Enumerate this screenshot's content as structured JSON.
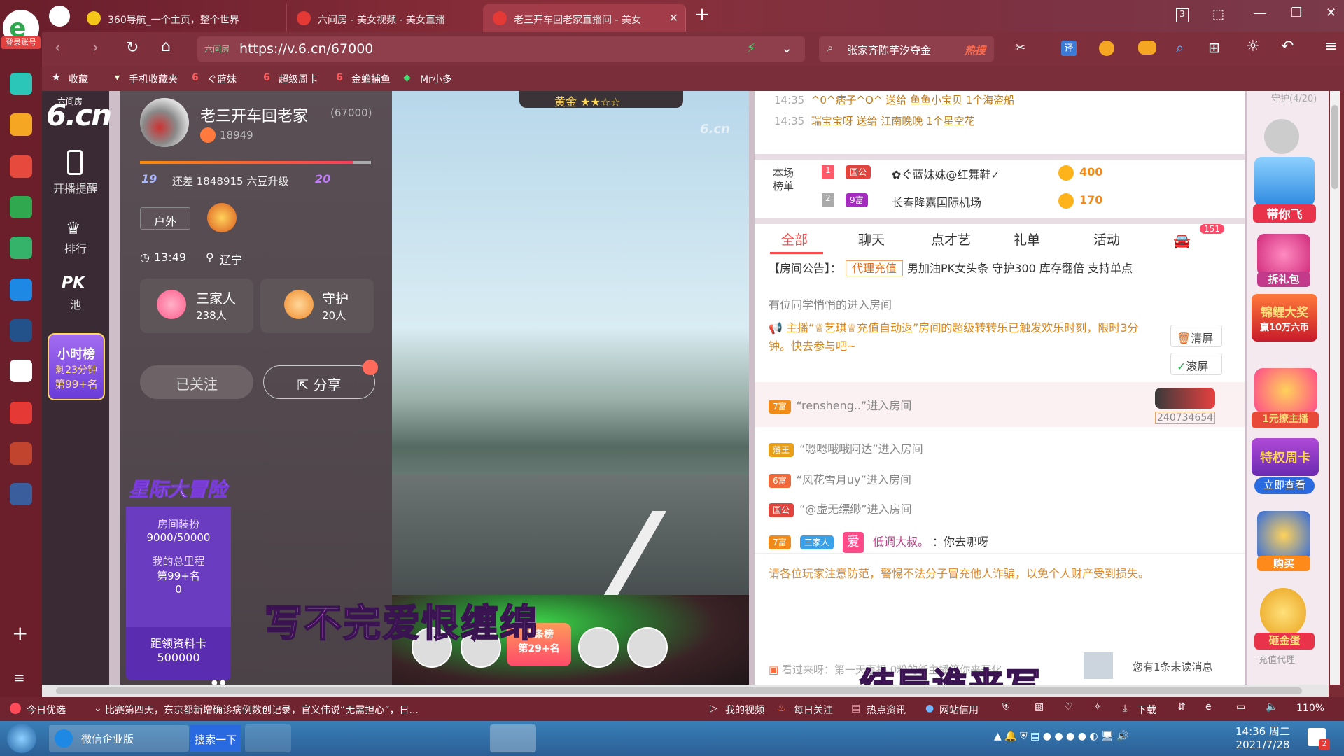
{
  "browser": {
    "login_label": "登录账号",
    "tabs": [
      {
        "title": "360导航_一个主页，整个世界"
      },
      {
        "title": "六间房 - 美女视频 - 美女直播"
      },
      {
        "title": "老三开车回老家直播间 - 美女"
      }
    ],
    "tab_count": "3",
    "url_site_label": "六间房",
    "url": "https://v.6.cn/67000",
    "search_text": "张家齐陈芋汐夺金",
    "hot_label": "热搜",
    "translate_label": "译",
    "bookmarks": [
      "收藏",
      "手机收藏夹",
      "ぐ蓝妹",
      "超级周卡",
      "金蟾捕鱼",
      "Mr小多"
    ]
  },
  "site": {
    "logo_top": "六间房",
    "logo_main": "6.cn",
    "nav": [
      {
        "label": "开播提醒"
      },
      {
        "label": "排行"
      },
      {
        "label": "池"
      }
    ],
    "pk_label": "PK",
    "hour_rank": {
      "title": "小时榜",
      "remain": "剩23分钟",
      "rank": "第99+名"
    }
  },
  "anchor": {
    "name": "老三开车回老家",
    "room_id": "(67000)",
    "fans": "18949",
    "level_from": "19",
    "level_text": "还差 1848915 六豆升级",
    "level_to": "20",
    "tag": "户外",
    "time": "13:49",
    "location": "辽宁",
    "family": {
      "label": "三家人",
      "count": "238人"
    },
    "guard": {
      "label": "守护",
      "count": "20人"
    },
    "followed_label": "已关注",
    "share_label": "分享",
    "adventure": {
      "title": "星际大冒险",
      "deco_label": "房间装扮",
      "deco_value": "9000/50000",
      "mileage_label": "我的总里程",
      "mileage_rank": "第99+名",
      "mileage_value": "0",
      "card_label": "距领资料卡",
      "card_value": "500000"
    }
  },
  "video": {
    "watermark": "6.cn",
    "rank_label": "头条榜",
    "rank_value": "第29+名",
    "gold_label": "黄金",
    "lyric1": "写不完爱恨缠绵",
    "lyric2": "结局谁来写"
  },
  "chat": {
    "gifts": [
      {
        "time": "14:35",
        "text": "^0^痞子^O^ 送给 鱼鱼小宝贝 1个海盗船"
      },
      {
        "time": "14:35",
        "text": "瑞宝宝呀 送给 江南晚晚 1个星空花"
      }
    ],
    "rank_title": "本场榜单",
    "ranks": [
      {
        "no": "1",
        "badge": "国公",
        "name": "✿ぐ蓝妹妹@红舞鞋✓",
        "value": "400"
      },
      {
        "no": "2",
        "badge": "9富",
        "name": "长春隆嘉国际机场",
        "value": "170"
      }
    ],
    "tabs": [
      {
        "label": "全部"
      },
      {
        "label": "聊天"
      },
      {
        "label": "点才艺"
      },
      {
        "label": "礼单"
      },
      {
        "label": "活动"
      }
    ],
    "car_count": "151",
    "notice_label": "【房间公告】：",
    "notice_tag": "代理充值",
    "notice_text": "男加油PK女头条 守护300 库存翻倍 支持单点",
    "sys1": "有位同学悄悄的进入房间",
    "sys2": "主播“♕艺琪♕充值自动返”房间的超级转转乐已触发欢乐时刻，限时3分钟。快去参与吧~",
    "clear_label": "清屏",
    "scroll_label": "滚屏",
    "car_id": "240734654",
    "entries": [
      {
        "badge": "7富",
        "text": "“rensheng..”进入房间"
      },
      {
        "badge": "藩王",
        "text": "“嗯嗯哦哦阿达”进入房间"
      },
      {
        "badge": "6富",
        "text": "“风花雪月uy”进入房间"
      },
      {
        "badge": "国公",
        "text": "“@虚无缥缈”进入房间"
      }
    ],
    "msg": {
      "badge": "7富",
      "family": "三家人",
      "love": "爱",
      "user": "低调大叔。",
      "text": "：你去哪呀"
    },
    "warning": "请各位玩家注意防范，警惕不法分子冒充他人诈骗，以免个人财产受到损失。",
    "ticker": "看过来呀：第一天直播 0粉的新主播等你来开化",
    "unread": "您有1条未读消息"
  },
  "rightcol": {
    "top_label": "守护(4/20)",
    "fly": "带你飞",
    "gift": "拆礼包",
    "lottery": "锦鲤大奖",
    "lottery_sub": "赢10万六币",
    "anchor_label": "1元撩主播",
    "weekly": "特权周卡",
    "weekly_btn": "立即查看",
    "buy": "购买",
    "egg": "砸金蛋",
    "agent": "充值代理"
  },
  "statusbar": {
    "left": "今日优选",
    "news": "比赛第四天，东京都新增确诊病例数创记录，官义伟说“无需担心”，日...",
    "items": [
      "我的视频",
      "每日关注",
      "热点资讯",
      "网站信用"
    ],
    "download": "下载",
    "zoom": "110%"
  },
  "taskbar": {
    "app": "微信企业版",
    "search": "搜索一下",
    "time": "14:36 周二",
    "date": "2021/7/28",
    "notif": "2"
  }
}
